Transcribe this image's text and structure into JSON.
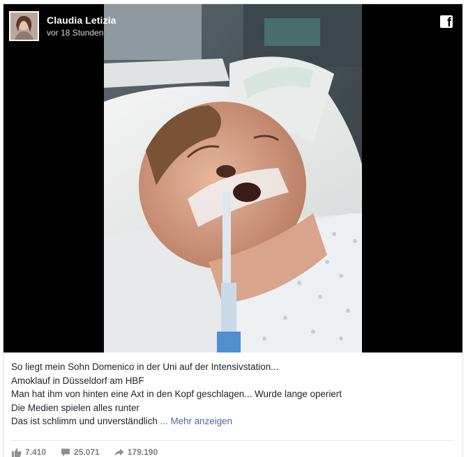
{
  "post": {
    "author": "Claudia Letizia",
    "time": "vor 18 Stunden",
    "logo_icon": "facebook-icon",
    "text_lines": [
      "So liegt mein Sohn Domenico in der Uni auf der Intensivstation...",
      "Amoklauf in Düsseldorf am HBF",
      "Man hat ihm von hinten eine Axt in den Kopf geschlagen... Wurde lange operiert",
      "Die Medien spielen alles runter",
      "Das ist schlimm und unverständlich"
    ],
    "ellipsis": " ... ",
    "more_link": "Mehr anzeigen",
    "stats": {
      "likes": "7.410",
      "comments": "25.071",
      "shares": "179.190"
    },
    "colors": {
      "media_bg": "#000000",
      "link": "#4b67a1",
      "stat_text": "#7f7f7f"
    }
  }
}
